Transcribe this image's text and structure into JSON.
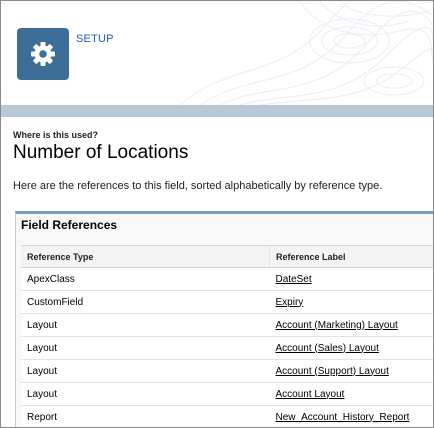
{
  "header": {
    "app_label": "SETUP",
    "icon": "gear-icon",
    "accent": "#3d6e98"
  },
  "page": {
    "eyebrow": "Where is this used?",
    "title": "Number of Locations",
    "description": "Here are the references to this field, sorted alphabetically by reference type."
  },
  "field_references": {
    "title": "Field References",
    "columns": [
      "Reference Type",
      "Reference Label"
    ],
    "rows": [
      {
        "type": "ApexClass",
        "label": "DateSet"
      },
      {
        "type": "CustomField",
        "label": "Expiry"
      },
      {
        "type": "Layout",
        "label": "Account (Marketing) Layout"
      },
      {
        "type": "Layout",
        "label": "Account (Sales) Layout"
      },
      {
        "type": "Layout",
        "label": "Account (Support) Layout"
      },
      {
        "type": "Layout",
        "label": "Account Layout"
      },
      {
        "type": "Report",
        "label": "New_Account_History_Report"
      }
    ]
  }
}
